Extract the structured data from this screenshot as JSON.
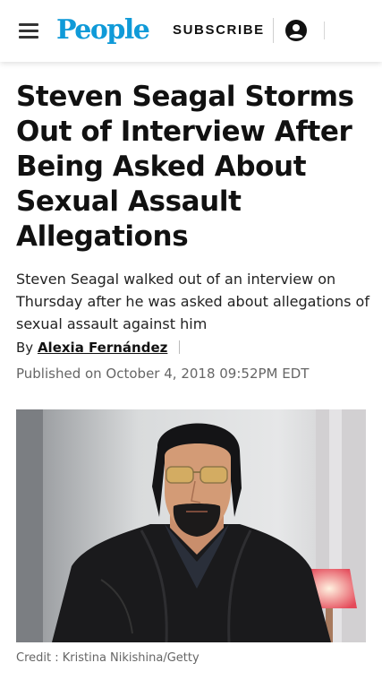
{
  "header": {
    "logo": "People",
    "subscribe_label": "SUBSCRIBE",
    "brand_color": "#0f9ad8",
    "menu_icon": "hamburger-menu-icon",
    "account_icon": "account-circle-icon"
  },
  "article": {
    "headline": "Steven Seagal Storms Out of Interview After Being Asked About Sexual Assault Allegations",
    "dek": "Steven Seagal walked out of an interview on Thursday after he was asked about allegations of sexual assault against him",
    "byline_prefix": "By",
    "author": "Alexia Fernández",
    "published": "Published on October 4, 2018 09:52PM EDT"
  },
  "image": {
    "credit": "Credit : Kristina Nikishina/Getty"
  }
}
